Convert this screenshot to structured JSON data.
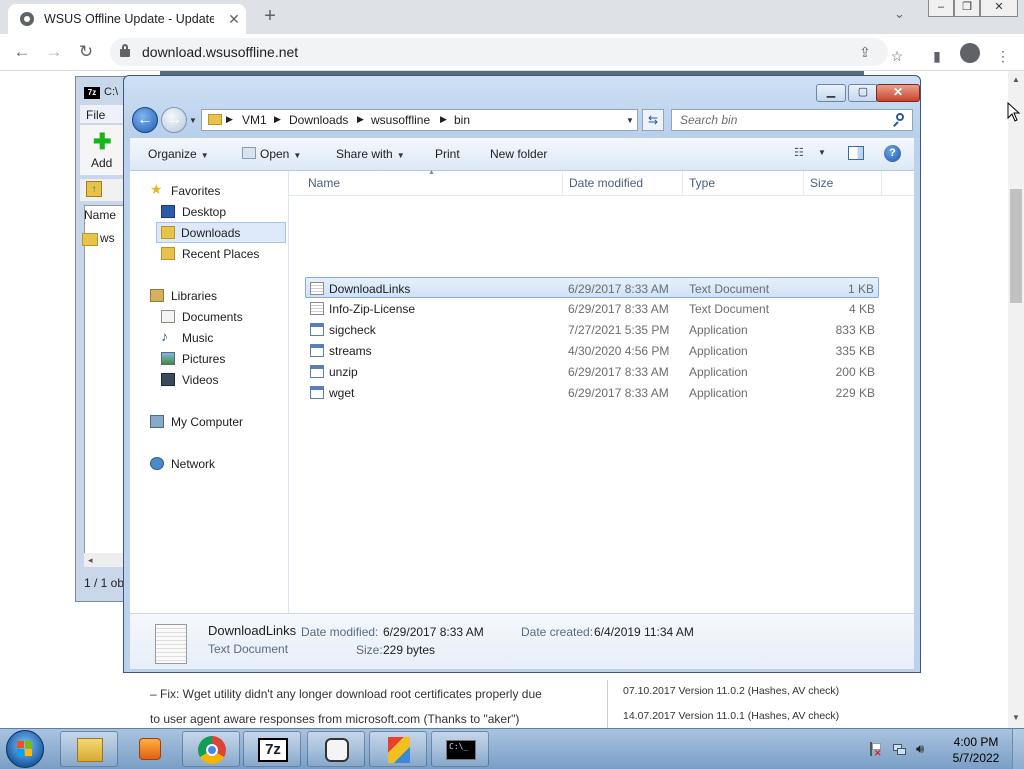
{
  "browser": {
    "tab_title": "WSUS Offline Update - Update M",
    "url": "download.wsusoffline.net",
    "icons": [
      "tab-favicon",
      "close-icon",
      "new-tab-icon",
      "back-icon",
      "forward-icon",
      "reload-icon",
      "lock-icon",
      "share-icon",
      "star-icon",
      "side-panel-icon",
      "profile-icon",
      "menu-icon"
    ]
  },
  "page": {
    "fix_line1": "– Fix: Wget utility didn't any longer download root certificates properly due",
    "fix_line2": "to user agent aware responses from microsoft.com (Thanks to \"aker\")",
    "version_1": "07.10.2017 Version 11.0.2 (Hashes, AV check)",
    "version_2": "14.07.2017 Version 11.0.1 (Hashes, AV check)"
  },
  "sevenzip": {
    "title": "C:\\",
    "menu_file": "File",
    "add_label": "Add",
    "col_name": "Name",
    "item": "ws",
    "status": "1 / 1 ob"
  },
  "explorer": {
    "breadcrumb": [
      "VM1",
      "Downloads",
      "wsusoffline",
      "bin"
    ],
    "search_placeholder": "Search bin",
    "commands": {
      "organize": "Organize",
      "open": "Open",
      "share_with": "Share with",
      "print": "Print",
      "new_folder": "New folder"
    },
    "nav": {
      "favorites": "Favorites",
      "desktop": "Desktop",
      "downloads": "Downloads",
      "recent_places": "Recent Places",
      "libraries": "Libraries",
      "documents": "Documents",
      "music": "Music",
      "pictures": "Pictures",
      "videos": "Videos",
      "my_computer": "My Computer",
      "network": "Network"
    },
    "columns": {
      "name": "Name",
      "date_modified": "Date modified",
      "type": "Type",
      "size": "Size"
    },
    "files": [
      {
        "name": "DownloadLinks",
        "date": "6/29/2017 8:33 AM",
        "type": "Text Document",
        "size": "1 KB",
        "kind": "txt"
      },
      {
        "name": "Info-Zip-License",
        "date": "6/29/2017 8:33 AM",
        "type": "Text Document",
        "size": "4 KB",
        "kind": "txt"
      },
      {
        "name": "sigcheck",
        "date": "7/27/2021 5:35 PM",
        "type": "Application",
        "size": "833 KB",
        "kind": "app"
      },
      {
        "name": "streams",
        "date": "4/30/2020 4:56 PM",
        "type": "Application",
        "size": "335 KB",
        "kind": "app"
      },
      {
        "name": "unzip",
        "date": "6/29/2017 8:33 AM",
        "type": "Application",
        "size": "200 KB",
        "kind": "app"
      },
      {
        "name": "wget",
        "date": "6/29/2017 8:33 AM",
        "type": "Application",
        "size": "229 KB",
        "kind": "app"
      }
    ],
    "details": {
      "name": "DownloadLinks",
      "type": "Text Document",
      "date_modified_label": "Date modified:",
      "date_modified": "6/29/2017 8:33 AM",
      "date_created_label": "Date created:",
      "date_created": "6/4/2019 11:34 AM",
      "size_label": "Size:",
      "size": "229 bytes"
    }
  },
  "taskbar": {
    "apps": [
      "explorer-icon",
      "media-player-icon",
      "chrome-icon",
      "7zip-icon",
      "unknown-app-icon",
      "installer-icon",
      "cmd-icon"
    ],
    "label_7z": "7z",
    "label_cmd": "C:\\_",
    "time": "4:00 PM",
    "date": "5/7/2022"
  },
  "colors": {
    "explorer_frame": "#bcd2ec",
    "selection": "#cfe2f8",
    "taskbar": "#8fb0d4"
  }
}
